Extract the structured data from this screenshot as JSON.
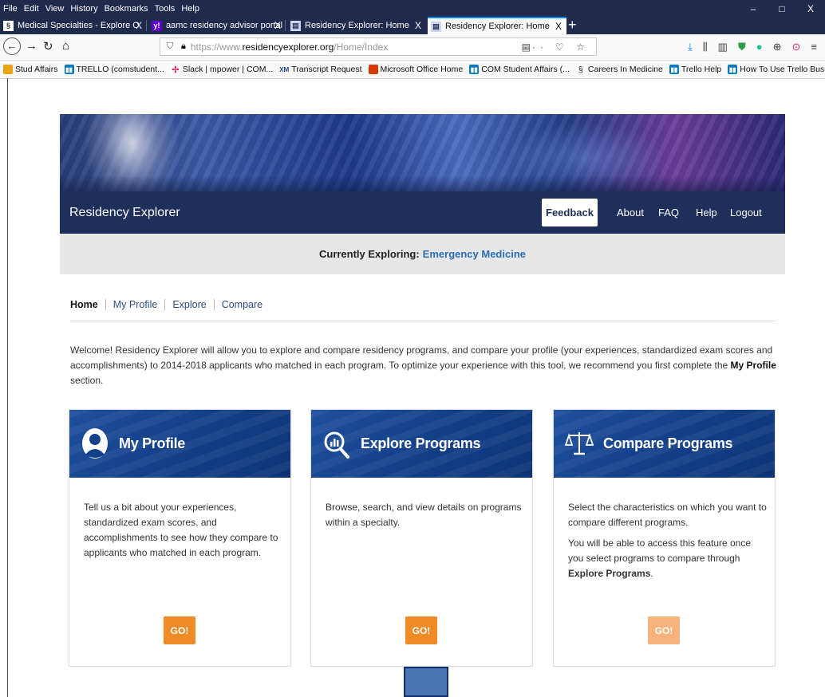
{
  "menubar": {
    "items": [
      "File",
      "Edit",
      "View",
      "History",
      "Bookmarks",
      "Tools",
      "Help"
    ]
  },
  "window_controls": {
    "minimize": "–",
    "maximize": "□",
    "close": "X"
  },
  "tabs": [
    {
      "title": "Medical Specialties - Explore O",
      "close": "X"
    },
    {
      "title": "aamc residency advisor portal",
      "close": "X"
    },
    {
      "title": "Residency Explorer: Home",
      "close": "X"
    },
    {
      "title": "Residency Explorer: Home",
      "close": "X"
    }
  ],
  "new_tab": "+",
  "nav": {
    "url_prefix": "https://www.",
    "url_domain": "residencyexplorer.org",
    "url_path": "/Home/Index",
    "page_actions": "··· ♡ ☆"
  },
  "bookmarks": [
    {
      "label": "Stud Affairs",
      "color": "#e8a317"
    },
    {
      "label": "TRELLO (comstudent...",
      "color": "#0079bf"
    },
    {
      "label": "Slack | mpower | COM...",
      "color": "#4a154b"
    },
    {
      "label": "Transcript Request",
      "color": "#1a3a8f"
    },
    {
      "label": "Microsoft Office Home",
      "color": "#d83b01"
    },
    {
      "label": "COM Student Affairs (...",
      "color": "#0079bf"
    },
    {
      "label": "Careers In Medicine",
      "color": "#555555"
    },
    {
      "label": "Trello Help",
      "color": "#0079bf"
    },
    {
      "label": "How To Use Trello Bus...",
      "color": "#0079bf"
    }
  ],
  "site": {
    "brand": "Residency Explorer",
    "feedback": "Feedback",
    "links": [
      "About",
      "FAQ",
      "Help",
      "Logout"
    ],
    "exploring_label": "Currently Exploring:",
    "exploring_specialty": "Emergency Medicine"
  },
  "breadcrumbs": [
    "Home",
    "My Profile",
    "Explore",
    "Compare"
  ],
  "welcome": {
    "text_1": "Welcome! Residency Explorer will allow you to explore and compare residency programs, and compare your profile (your experiences, standardized exam scores and accomplishments) to 2014-2018 applicants who matched in each program. To optimize your experience with this tool, we recommend you first complete the ",
    "bold": "My Profile",
    "text_2": " section."
  },
  "cards": [
    {
      "title": "My Profile",
      "icon": "user-icon",
      "p1": "Tell us a bit about your experiences, standardized exam scores, and accomplishments to see how they compare to applicants who matched in each program.",
      "go": "GO!"
    },
    {
      "title": "Explore Programs",
      "icon": "search-chart-icon",
      "p1": "Browse, search, and view details on programs within a specialty.",
      "go": "GO!"
    },
    {
      "title": "Compare Programs",
      "icon": "scales-icon",
      "p1": "Select the characteristics on which you want to compare different programs.",
      "p2a": "You will be able to access this feature once you select programs to compare through ",
      "p2b": "Explore Programs",
      "p2c": ".",
      "go": "GO!"
    }
  ],
  "colors": {
    "navy": "#1f2f5c",
    "accent": "#2a6fb5",
    "go": "#f08a24",
    "go_disabled": "#f6b27a"
  }
}
